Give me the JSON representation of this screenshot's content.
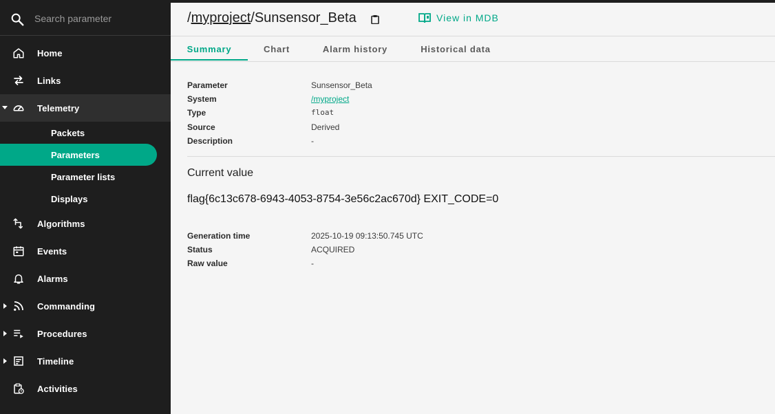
{
  "search": {
    "placeholder": "Search parameter"
  },
  "sidebar": {
    "items": [
      {
        "label": "Home"
      },
      {
        "label": "Links"
      },
      {
        "label": "Telemetry"
      },
      {
        "label": "Algorithms"
      },
      {
        "label": "Events"
      },
      {
        "label": "Alarms"
      },
      {
        "label": "Commanding"
      },
      {
        "label": "Procedures"
      },
      {
        "label": "Timeline"
      },
      {
        "label": "Activities"
      }
    ],
    "telemetry_sub": [
      {
        "label": "Packets"
      },
      {
        "label": "Parameters"
      },
      {
        "label": "Parameter lists"
      },
      {
        "label": "Displays"
      }
    ]
  },
  "header": {
    "title_prefix": "/",
    "system_link": "myproject",
    "title_suffix": "/Sunsensor_Beta",
    "mdb_link": "View in MDB"
  },
  "tabs": [
    {
      "label": "Summary"
    },
    {
      "label": "Chart"
    },
    {
      "label": "Alarm history"
    },
    {
      "label": "Historical data"
    }
  ],
  "summary": {
    "parameter_label": "Parameter",
    "parameter_value": "Sunsensor_Beta",
    "system_label": "System",
    "system_value": "/myproject",
    "type_label": "Type",
    "type_value": "float",
    "source_label": "Source",
    "source_value": "Derived",
    "description_label": "Description",
    "description_value": "-"
  },
  "current": {
    "title": "Current value",
    "value": "flag{6c13c678-6943-4053-8754-3e56c2ac670d} EXIT_CODE=0",
    "generation_label": "Generation time",
    "generation_value": "2025-10-19 09:13:50.745 UTC",
    "status_label": "Status",
    "status_value": "ACQUIRED",
    "raw_label": "Raw value",
    "raw_value": "-"
  },
  "colors": {
    "accent": "#00a888",
    "sidebar_bg": "#1e1e1e",
    "content_bg": "#f5f5f5"
  }
}
